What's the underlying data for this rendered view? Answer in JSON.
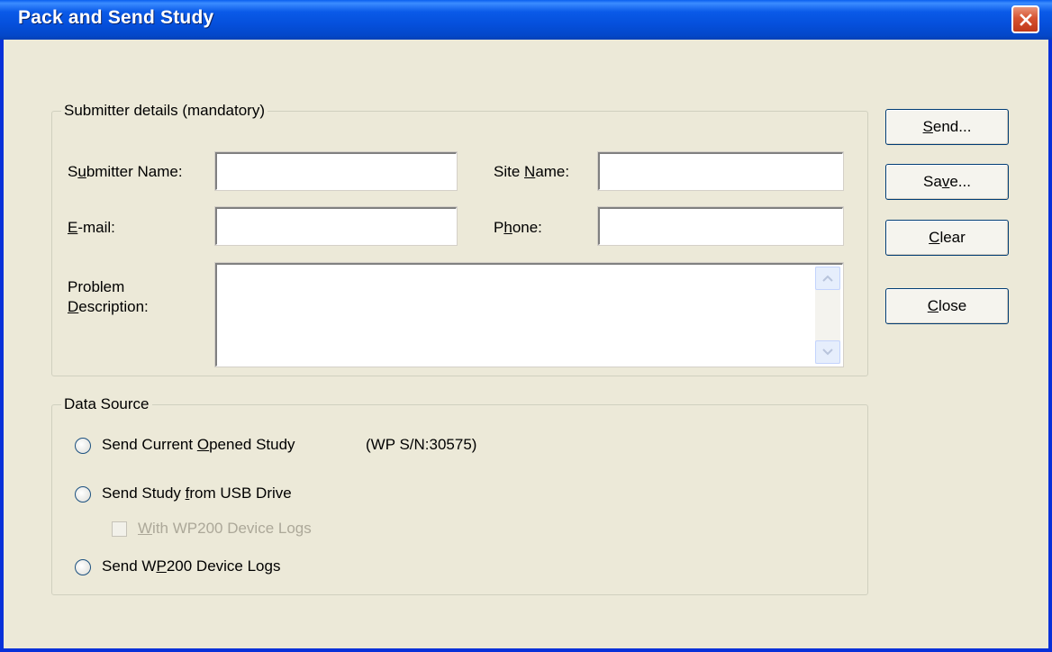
{
  "window": {
    "title": "Pack and Send Study"
  },
  "submitter": {
    "legend": "Submitter details (mandatory)",
    "name": {
      "label_pre": "S",
      "label_acc": "u",
      "label_post": "bmitter Name:",
      "value": ""
    },
    "site": {
      "label_pre": "Site ",
      "label_acc": "N",
      "label_post": "ame:",
      "value": ""
    },
    "email": {
      "label_pre": "",
      "label_acc": "E",
      "label_post": "-mail:",
      "value": ""
    },
    "phone": {
      "label_pre": "P",
      "label_acc": "h",
      "label_post": "one:",
      "value": ""
    },
    "problem": {
      "line1": "Problem",
      "line2_acc": "D",
      "line2_post": "escription:",
      "value": ""
    }
  },
  "data_source": {
    "legend": "Data Source",
    "opt_current": {
      "pre": "Send Current ",
      "acc": "O",
      "post": "pened Study"
    },
    "serial": "(WP S/N:30575)",
    "opt_usb": {
      "pre": "Send Study ",
      "acc": "f",
      "post": "rom USB Drive"
    },
    "chk_logs": {
      "pre": "",
      "acc": "W",
      "post": "ith WP200 Device Logs",
      "checked": false
    },
    "opt_logs": {
      "pre": "Send W",
      "acc": "P",
      "post": "200 Device Logs"
    }
  },
  "buttons": {
    "send": {
      "acc": "S",
      "post": "end..."
    },
    "save": {
      "pre": "Sa",
      "acc": "v",
      "post": "e..."
    },
    "clear": {
      "pre": "",
      "acc": "C",
      "post": "lear"
    },
    "close": {
      "pre": "",
      "acc": "C",
      "post": "lose"
    }
  },
  "icons": {
    "close": "close-icon",
    "scroll_up": "scroll-up-icon",
    "scroll_down": "scroll-down-icon"
  }
}
